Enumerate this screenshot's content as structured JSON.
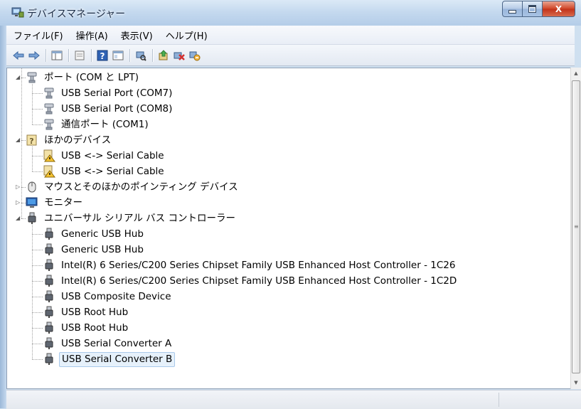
{
  "window": {
    "title": "デバイスマネージャー",
    "icons": {
      "app": "device-manager-icon",
      "minimize": "minimize-icon",
      "maximize": "maximize-icon",
      "close": "close-icon"
    },
    "close_glyph": "X"
  },
  "menu": [
    "ファイル(F)",
    "操作(A)",
    "表示(V)",
    "ヘルプ(H)"
  ],
  "toolbar": [
    "back-arrow-icon",
    "forward-arrow-icon",
    "console-tree-icon",
    "properties-icon",
    "help-icon",
    "view-icon",
    "scan-hardware-icon",
    "update-driver-icon",
    "disable-device-icon",
    "uninstall-device-icon"
  ],
  "tree": [
    {
      "label": "ポート (COM と LPT)",
      "level": 0,
      "expanded": true,
      "icon": "port-icon"
    },
    {
      "label": "USB Serial Port (COM7)",
      "level": 1,
      "icon": "port-icon"
    },
    {
      "label": "USB Serial Port (COM8)",
      "level": 1,
      "icon": "port-icon"
    },
    {
      "label": "通信ポート (COM1)",
      "level": 1,
      "icon": "port-icon"
    },
    {
      "label": "ほかのデバイス",
      "level": 0,
      "expanded": true,
      "icon": "unknown-device-icon"
    },
    {
      "label": "USB <-> Serial Cable",
      "level": 1,
      "icon": "warning-device-icon"
    },
    {
      "label": "USB <-> Serial Cable",
      "level": 1,
      "icon": "warning-device-icon"
    },
    {
      "label": "マウスとそのほかのポインティング デバイス",
      "level": 0,
      "expanded": false,
      "icon": "mouse-icon"
    },
    {
      "label": "モニター",
      "level": 0,
      "expanded": false,
      "icon": "monitor-icon"
    },
    {
      "label": "ユニバーサル シリアル バス コントローラー",
      "level": 0,
      "expanded": true,
      "icon": "usb-plug-icon"
    },
    {
      "label": "Generic USB Hub",
      "level": 1,
      "icon": "usb-plug-icon"
    },
    {
      "label": "Generic USB Hub",
      "level": 1,
      "icon": "usb-plug-icon"
    },
    {
      "label": "Intel(R) 6 Series/C200 Series Chipset Family USB Enhanced Host Controller - 1C26",
      "level": 1,
      "icon": "usb-plug-icon"
    },
    {
      "label": "Intel(R) 6 Series/C200 Series Chipset Family USB Enhanced Host Controller - 1C2D",
      "level": 1,
      "icon": "usb-plug-icon"
    },
    {
      "label": "USB Composite Device",
      "level": 1,
      "icon": "usb-plug-icon"
    },
    {
      "label": "USB Root Hub",
      "level": 1,
      "icon": "usb-plug-icon"
    },
    {
      "label": "USB Root Hub",
      "level": 1,
      "icon": "usb-plug-icon"
    },
    {
      "label": "USB Serial Converter A",
      "level": 1,
      "icon": "usb-plug-icon"
    },
    {
      "label": "USB Serial Converter B",
      "level": 1,
      "icon": "usb-plug-icon",
      "selected": true
    }
  ],
  "scrollbar": {
    "up": "scroll-up-icon",
    "down": "scroll-down-icon"
  }
}
